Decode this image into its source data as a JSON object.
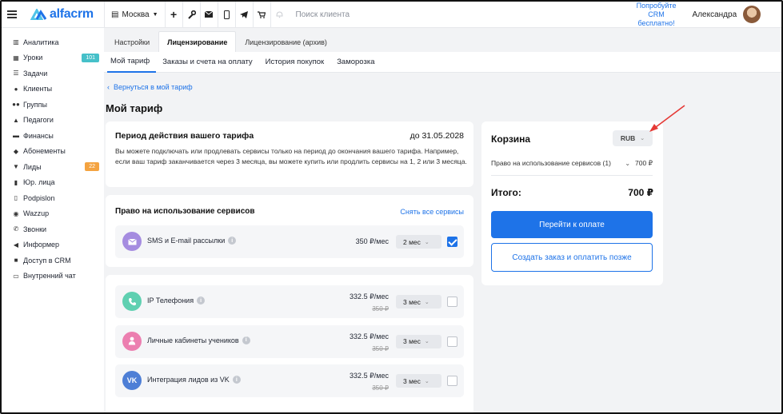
{
  "topbar": {
    "logo_text": "alfacrm",
    "branch": "Москва",
    "search_placeholder": "Поиск клиента",
    "promo_line1": "Попробуйте",
    "promo_line2": "CRM бесплатно!",
    "user_name": "Александра"
  },
  "sidebar": {
    "items": [
      {
        "label": "Аналитика",
        "icon": "chart-icon"
      },
      {
        "label": "Уроки",
        "icon": "calendar-icon",
        "badge": "101"
      },
      {
        "label": "Задачи",
        "icon": "tasks-icon"
      },
      {
        "label": "Клиенты",
        "icon": "user-icon"
      },
      {
        "label": "Группы",
        "icon": "users-icon"
      },
      {
        "label": "Педагоги",
        "icon": "graduation-cap-icon"
      },
      {
        "label": "Финансы",
        "icon": "money-icon"
      },
      {
        "label": "Абонементы",
        "icon": "tag-icon"
      },
      {
        "label": "Лиды",
        "icon": "funnel-icon",
        "badge": "22"
      },
      {
        "label": "Юр. лица",
        "icon": "building-icon"
      },
      {
        "label": "Podpislon",
        "icon": "document-icon"
      },
      {
        "label": "Wazzup",
        "icon": "whatsapp-icon"
      },
      {
        "label": "Звонки",
        "icon": "phone-icon"
      },
      {
        "label": "Информер",
        "icon": "megaphone-icon"
      },
      {
        "label": "Доступ в CRM",
        "icon": "lock-icon"
      },
      {
        "label": "Внутренний чат",
        "icon": "chat-icon"
      }
    ]
  },
  "tabs_primary": [
    "Настройки",
    "Лицензирование",
    "Лицензирование (архив)"
  ],
  "tabs_secondary": [
    "Мой тариф",
    "Заказы и счета на оплату",
    "История покупок",
    "Заморозка"
  ],
  "back_link": "Вернуться в мой тариф",
  "page_title": "Мой тариф",
  "period": {
    "title": "Период действия вашего тарифа",
    "date": "до 31.05.2028",
    "text": "Вы можете подключать или продлевать сервисы только на период до окончания вашего тарифа. Например, если ваш тариф заканчивается через 3 месяца, вы можете купить или продлить сервисы на 1, 2 или 3 месяца."
  },
  "services_title": "Право на использование сервисов",
  "unselect_all": "Снять все сервисы",
  "selected_services": [
    {
      "name": "SMS и E-mail рассылки",
      "price": "350 ₽/мес",
      "period": "2 мес",
      "checked": true,
      "color": "#a58ce0",
      "icon": "envelope-icon"
    }
  ],
  "services": [
    {
      "name": "IP Телефония",
      "price": "332.5 ₽/мес",
      "old": "350 ₽",
      "period": "3 мес",
      "checked": false,
      "color": "#5fd0b1",
      "icon": "phone-icon"
    },
    {
      "name": "Личные кабинеты учеников",
      "price": "332.5 ₽/мес",
      "old": "350 ₽",
      "period": "3 мес",
      "checked": false,
      "color": "#ec7fb0",
      "icon": "person-icon"
    },
    {
      "name": "Интеграция лидов из VK",
      "price": "332.5 ₽/мес",
      "old": "350 ₽",
      "period": "3 мес",
      "checked": false,
      "color": "#4e7fd6",
      "icon": "vk-icon"
    }
  ],
  "cart": {
    "title": "Корзина",
    "currency": "RUB",
    "line_label": "Право на использование сервисов (1)",
    "line_value": "700 ₽",
    "total_label": "Итого:",
    "total_value": "700 ₽",
    "pay_button": "Перейти к оплате",
    "order_button": "Создать заказ и оплатить позже"
  },
  "colors": {
    "accent": "#1e73e8",
    "arrow": "#e53935"
  }
}
